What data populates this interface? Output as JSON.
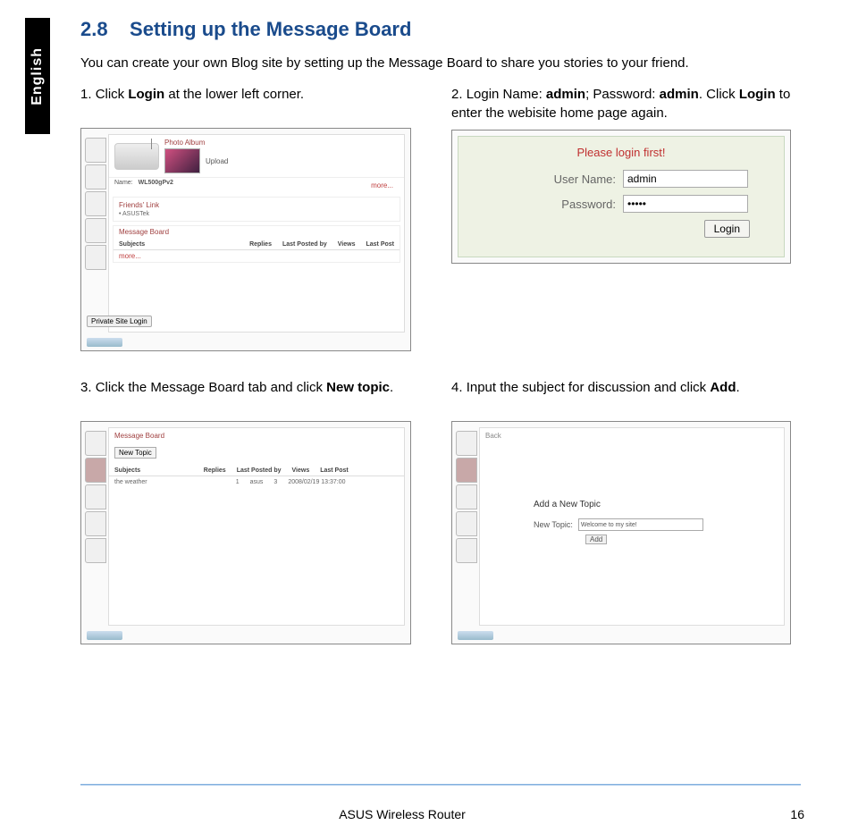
{
  "side_tab": "English",
  "heading_num": "2.8",
  "heading_text": "Setting up the Message Board",
  "intro": "You can create your own Blog site by setting up the Message Board to share you stories to your friend.",
  "step1": {
    "num": "1.",
    "pre": "Click ",
    "bold": "Login",
    "post": " at the lower left corner."
  },
  "step2": {
    "num": "2.",
    "pre": "Login Name: ",
    "b1": "admin",
    "mid": "; Password: ",
    "b2": "admin",
    "mid2": ". Click ",
    "b3": "Login",
    "post": " to enter the webisite home page again."
  },
  "step3": {
    "num": "3.",
    "pre": "Click the Message Board tab and click ",
    "bold": "New topic",
    "post": "."
  },
  "step4": {
    "num": "4.",
    "pre": "Input the subject for discussion and click ",
    "bold": "Add",
    "post": "."
  },
  "shot1": {
    "photo_album": "Photo Album",
    "name_label": "Name:",
    "name_value": "WL500gPv2",
    "upload": "Upload",
    "more": "more...",
    "friends_link_title": "Friends' Link",
    "friends_link_item": "• ASUSTek",
    "mb_title": "Message Board",
    "cols": [
      "Subjects",
      "Replies",
      "Last Posted by",
      "Views",
      "Last Post"
    ],
    "login_btn": "Private Site Login"
  },
  "shot2": {
    "title": "Please login first!",
    "user_label": "User Name:",
    "user_value": "admin",
    "pass_label": "Password:",
    "pass_value": "•••••",
    "button": "Login"
  },
  "shot3": {
    "mb_title": "Message Board",
    "new_topic": "New Topic",
    "cols": [
      "Subjects",
      "Replies",
      "Last Posted by",
      "Views",
      "Last Post"
    ],
    "row": [
      "the weather",
      "1",
      "asus",
      "3",
      "2008/02/19 13:37:00"
    ]
  },
  "shot4": {
    "back": "Back",
    "title": "Add a New Topic",
    "label": "New Topic:",
    "value": "Welcome to my site!",
    "button": "Add"
  },
  "footer": {
    "title": "ASUS Wireless Router",
    "page": "16"
  }
}
